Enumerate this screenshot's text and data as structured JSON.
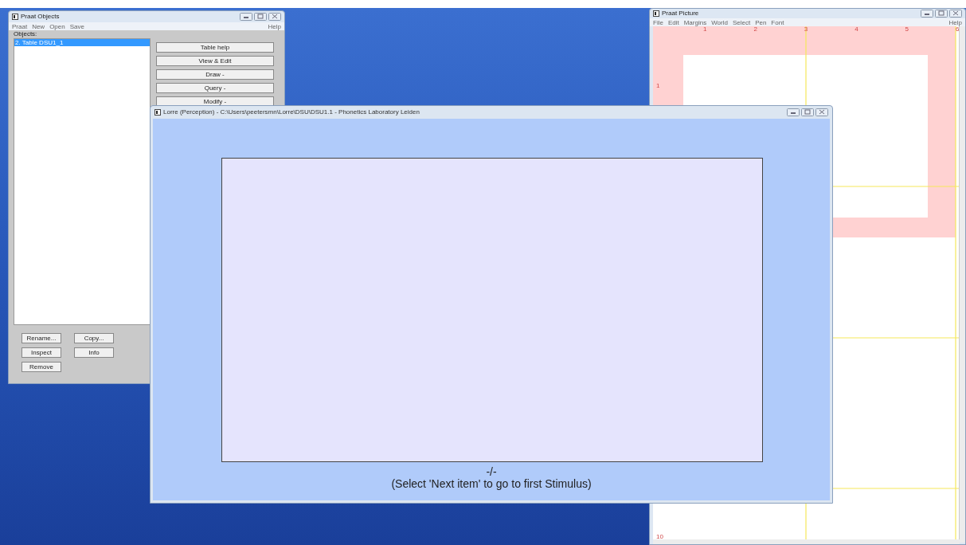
{
  "objects_window": {
    "title": "Praat Objects",
    "menu": [
      "Praat",
      "New",
      "Open",
      "Save"
    ],
    "help": "Help",
    "list_label": "Objects:",
    "items": [
      {
        "label": "2. Table DSU1_1",
        "selected": true
      }
    ],
    "action_buttons": [
      "Table help",
      "View & Edit",
      "Draw -",
      "Query -",
      "Modify -"
    ],
    "bottom_buttons": [
      [
        "Rename...",
        "Copy..."
      ],
      [
        "Inspect",
        "Info"
      ],
      [
        "Remove"
      ]
    ]
  },
  "picture_window": {
    "title": "Praat Picture",
    "menu": [
      "File",
      "Edit",
      "Margins",
      "World",
      "Select",
      "Pen",
      "Font"
    ],
    "help": "Help",
    "top_ruler": [
      "1",
      "2",
      "3",
      "4",
      "5",
      "6"
    ],
    "left_ruler": [
      {
        "label": "1"
      },
      {
        "label": "10"
      }
    ]
  },
  "lorre_window": {
    "title": "Lorre (Perception) - C:\\Users\\peetersmn\\Lorre\\DSU\\DSU1.1 - Phonetics Laboratory Leiden",
    "progress": "-/-",
    "instruction": "(Select 'Next item' to go to first Stimulus)"
  }
}
